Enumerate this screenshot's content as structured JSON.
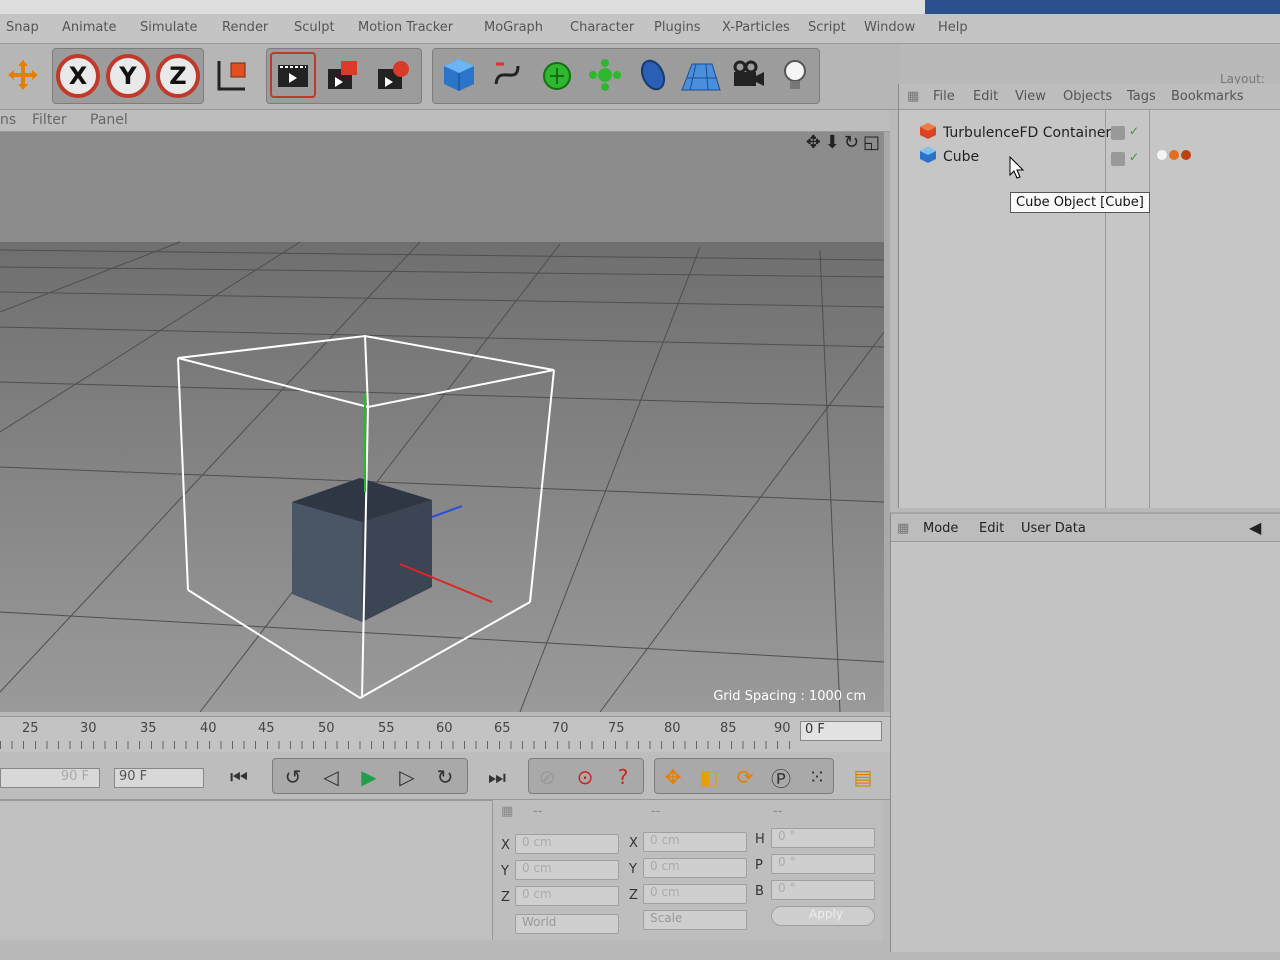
{
  "menubar": {
    "items": [
      "Snap",
      "Animate",
      "Simulate",
      "Render",
      "Sculpt",
      "Motion Tracker",
      "MoGraph",
      "Character",
      "Plugins",
      "X-Particles",
      "Script",
      "Window",
      "Help"
    ],
    "layout_label": "Layout:"
  },
  "toolbar": {
    "axis_x": "X",
    "axis_y": "Y",
    "axis_z": "Z",
    "icons": [
      "move-icon",
      "x-axis-icon",
      "y-axis-icon",
      "z-axis-icon",
      "coordinate-system-icon",
      "render-view-icon",
      "render-region-icon",
      "render-settings-icon",
      "cube-primitive-icon",
      "spline-pen-icon",
      "subdivision-icon",
      "cloner-icon",
      "deformer-icon",
      "floor-icon",
      "camera-icon",
      "light-icon"
    ]
  },
  "viewport": {
    "menu_partial": "ns",
    "menu_filter": "Filter",
    "menu_panel": "Panel",
    "grid_spacing": "Grid Spacing : 1000 cm"
  },
  "timeline": {
    "ticks": [
      "25",
      "30",
      "35",
      "40",
      "45",
      "50",
      "55",
      "60",
      "65",
      "70",
      "75",
      "80",
      "85",
      "90"
    ],
    "current_frame": "0 F"
  },
  "transport": {
    "min_frame": "90 F",
    "max_frame": "90 F"
  },
  "coords": {
    "header": [
      "--",
      "--",
      "--"
    ],
    "pos_labels": [
      "X",
      "Y",
      "Z"
    ],
    "scale_labels": [
      "X",
      "Y",
      "Z"
    ],
    "rot_labels": [
      "H",
      "P",
      "B"
    ],
    "pos_values": [
      "0 cm",
      "0 cm",
      "0 cm"
    ],
    "scale_values": [
      "0 cm",
      "0 cm",
      "0 cm"
    ],
    "rot_values": [
      "0 °",
      "0 °",
      "0 °"
    ],
    "world_select": "World",
    "scale_select": "Scale",
    "apply_label": "Apply"
  },
  "object_manager": {
    "menu": [
      "File",
      "Edit",
      "View",
      "Objects",
      "Tags",
      "Bookmarks"
    ],
    "objects": [
      {
        "name": "TurbulenceFD Container",
        "icon": "turbulencefd-icon"
      },
      {
        "name": "Cube",
        "icon": "cube-icon"
      }
    ],
    "tooltip": "Cube Object [Cube]"
  },
  "attribute_manager": {
    "menu": [
      "Mode",
      "Edit",
      "User Data"
    ]
  },
  "colors": {
    "axis_ring": "#c0392b",
    "viewport_bg": "#8a8a8a",
    "cube": "#4a5566",
    "selection_box": "#ffffff"
  }
}
